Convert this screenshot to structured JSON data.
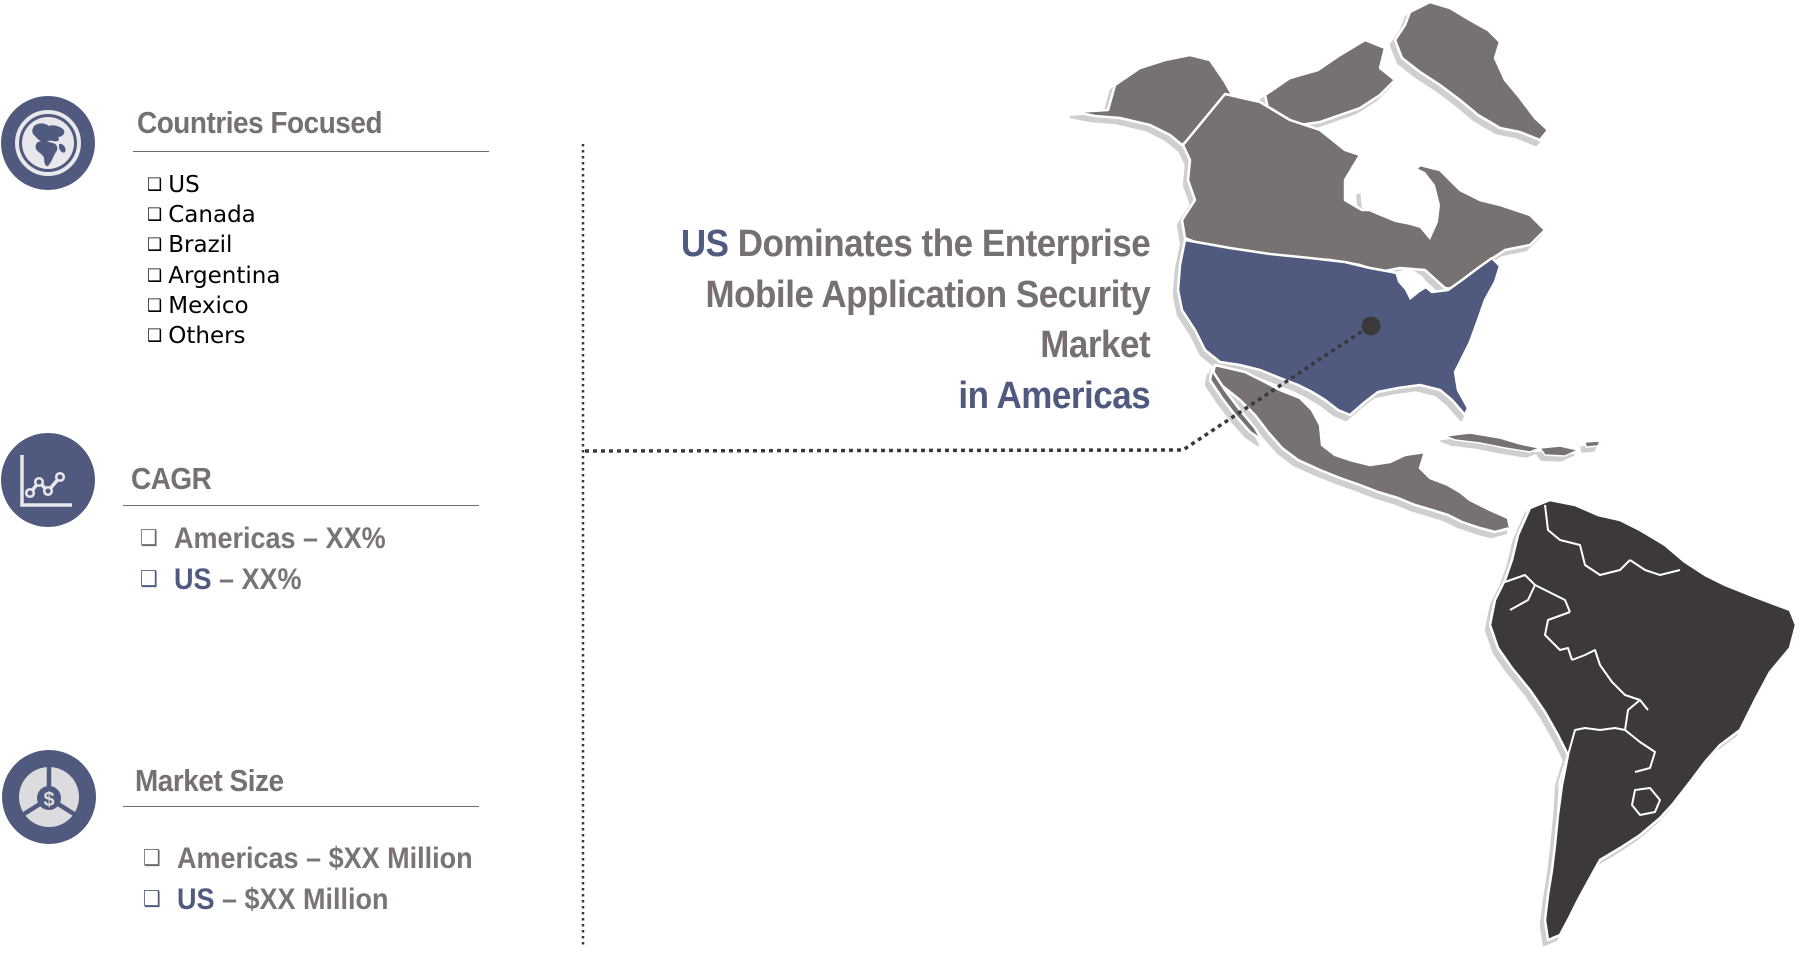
{
  "colors": {
    "accent_blue": "#4f5a7e",
    "heading_gray": "#767070",
    "north_america_gray": "#777171",
    "south_america_dark": "#3c393a",
    "us_blue": "#4f5a7e",
    "connector_dark": "#3a3a3a"
  },
  "sections": {
    "countries": {
      "icon": "globe-icon",
      "title": "Countries Focused",
      "items": [
        "US",
        "Canada",
        "Brazil",
        "Argentina",
        "Mexico",
        "Others"
      ]
    },
    "cagr": {
      "icon": "line-chart-icon",
      "title": "CAGR",
      "items": [
        {
          "highlight": "Americas",
          "rest": " – XX%",
          "highlighted_blue": false
        },
        {
          "highlight": "US",
          "rest": " – XX%",
          "highlighted_blue": true
        }
      ]
    },
    "market_size": {
      "icon": "dollar-pie-icon",
      "title": "Market Size",
      "items": [
        {
          "highlight": "Americas",
          "rest": " – $XX Million",
          "highlighted_blue": false
        },
        {
          "highlight": "US",
          "rest": " – $XX Million",
          "highlighted_blue": true
        }
      ]
    }
  },
  "checkbox_glyph": "❑",
  "headline": {
    "line1_highlight": "US",
    "line1_rest": " Dominates the Enterprise",
    "line2": "Mobile Application Security",
    "line3": "Market",
    "line4": "in Americas"
  },
  "map": {
    "regions": [
      {
        "name": "North America (Canada, Alaska, Greenland, Mexico, Central America, Caribbean)",
        "style": "gray"
      },
      {
        "name": "United States (contiguous)",
        "style": "highlighted-blue"
      },
      {
        "name": "South America",
        "style": "dark"
      }
    ],
    "marker": "US"
  }
}
